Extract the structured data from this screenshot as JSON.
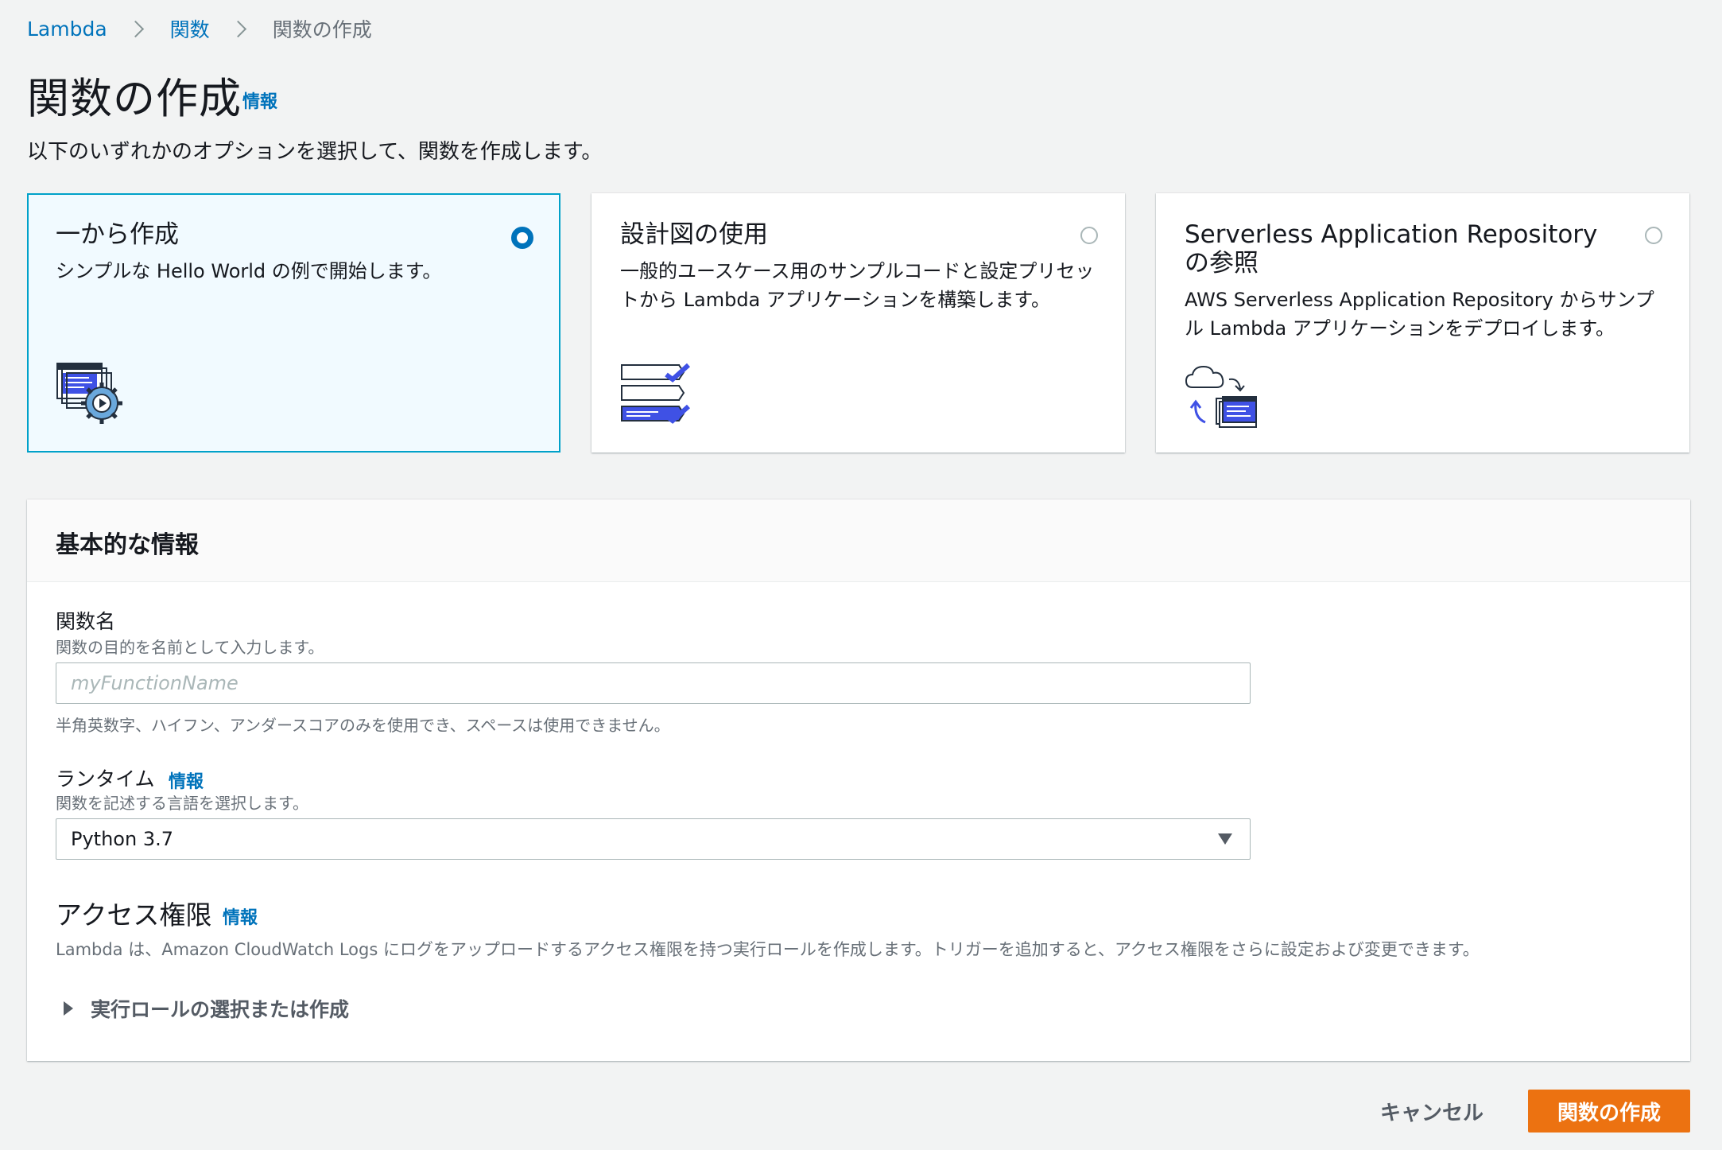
{
  "breadcrumb": {
    "items": [
      "Lambda",
      "関数"
    ],
    "current": "関数の作成"
  },
  "header": {
    "title": "関数の作成",
    "info": "情報",
    "description": "以下のいずれかのオプションを選択して、関数を作成します。"
  },
  "options": [
    {
      "title": "一から作成",
      "description": "シンプルな Hello World の例で開始します。",
      "selected": true,
      "icon": "author-from-scratch-icon"
    },
    {
      "title": "設計図の使用",
      "description": "一般的ユースケース用のサンプルコードと設定プリセットから Lambda アプリケーションを構築します。",
      "selected": false,
      "icon": "blueprint-checklist-icon"
    },
    {
      "title": "Serverless Application Repository の参照",
      "description": "AWS Serverless Application Repository からサンプル Lambda アプリケーションをデプロイします。",
      "selected": false,
      "icon": "cloud-deploy-icon"
    }
  ],
  "basic_info": {
    "title": "基本的な情報",
    "function_name": {
      "label": "関数名",
      "hint": "関数の目的を名前として入力します。",
      "placeholder": "myFunctionName",
      "value": "",
      "constraint": "半角英数字、ハイフン、アンダースコアのみを使用でき、スペースは使用できません。"
    },
    "runtime": {
      "label": "ランタイム",
      "info": "情報",
      "hint": "関数を記述する言語を選択します。",
      "value": "Python 3.7"
    },
    "permissions": {
      "title": "アクセス権限",
      "info": "情報",
      "description": "Lambda は、Amazon CloudWatch Logs にログをアップロードするアクセス権限を持つ実行ロールを作成します。トリガーを追加すると、アクセス権限をさらに設定および変更できます。",
      "expand_label": "実行ロールの選択または作成"
    }
  },
  "actions": {
    "cancel": "キャンセル",
    "create": "関数の作成"
  },
  "colors": {
    "link": "#0073bb",
    "primary_button": "#ec7211",
    "selected_card_border": "#00a1c9",
    "selected_card_bg": "#f1faff",
    "page_bg": "#f2f3f3"
  }
}
